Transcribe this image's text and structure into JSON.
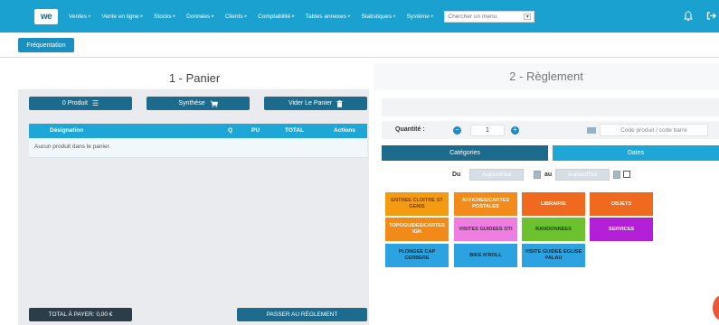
{
  "nav": {
    "logo": "we",
    "menu": [
      "Ventes",
      "Vente en ligne",
      "Stocks",
      "Données",
      "Clients",
      "Comptabilité",
      "Tables annexes",
      "Statistiques",
      "Système"
    ],
    "search_placeholder": "Chercher un menu"
  },
  "page": {
    "frequentation_label": "Fréquentation",
    "left_title": "1 - Panier",
    "right_title": "2 - Règlement"
  },
  "panier": {
    "produits_label": "0 Produit",
    "synthese_label": "Synthèse",
    "vider_label": "Vider Le Panier",
    "columns": [
      "Désignation",
      "Q",
      "PU",
      "TOTAL",
      "Actions"
    ],
    "empty_text": "Aucun produit dans le panier.",
    "total_label": "TOTAL À PAYER: 0,00 €",
    "passer_label": "PASSER AU RÈGLEMENT"
  },
  "reglement": {
    "quantite_label": "Quantité :",
    "quantite_value": "1",
    "code_placeholder": "Code produit / code barre",
    "tab_categories": "Catégories",
    "tab_dates": "Dates",
    "du_label": "Du",
    "au_label": "au",
    "date_from": "Aujourd'hui",
    "date_to": "Aujourd'hui"
  },
  "categories": [
    {
      "label": "ENTREE CLOITRE ST GENIS",
      "bg": "#f39c12",
      "fg": "#7a3d00"
    },
    {
      "label": "AFFICHES/CARTES POSTALES",
      "bg": "#f38b1c",
      "fg": "#ffffff"
    },
    {
      "label": "LIBRAIRIE",
      "bg": "#ef6a1e",
      "fg": "#ffffff"
    },
    {
      "label": "OBJETS",
      "bg": "#ef6a1e",
      "fg": "#ffffff"
    },
    {
      "label": "TOPOGUIDES/CARTES IGN",
      "bg": "#f28a1a",
      "fg": "#ffffff"
    },
    {
      "label": "VISITES GUIDEES OTI",
      "bg": "#ee7fe0",
      "fg": "#333333"
    },
    {
      "label": "RANDONNEES",
      "bg": "#6bc12e",
      "fg": "#1e3d0a"
    },
    {
      "label": "SERVICES",
      "bg": "#b21fd6",
      "fg": "#ffffff"
    },
    {
      "label": "PLONGEE CAP CERBERE",
      "bg": "#2aa3e0",
      "fg": "#0d2b3d"
    },
    {
      "label": "BIKE N'ROLL",
      "bg": "#2aa3e0",
      "fg": "#0d2b3d"
    },
    {
      "label": "VISITE GUIDEE EGLISE PALAU",
      "bg": "#2aa3e0",
      "fg": "#0d2b3d"
    }
  ]
}
